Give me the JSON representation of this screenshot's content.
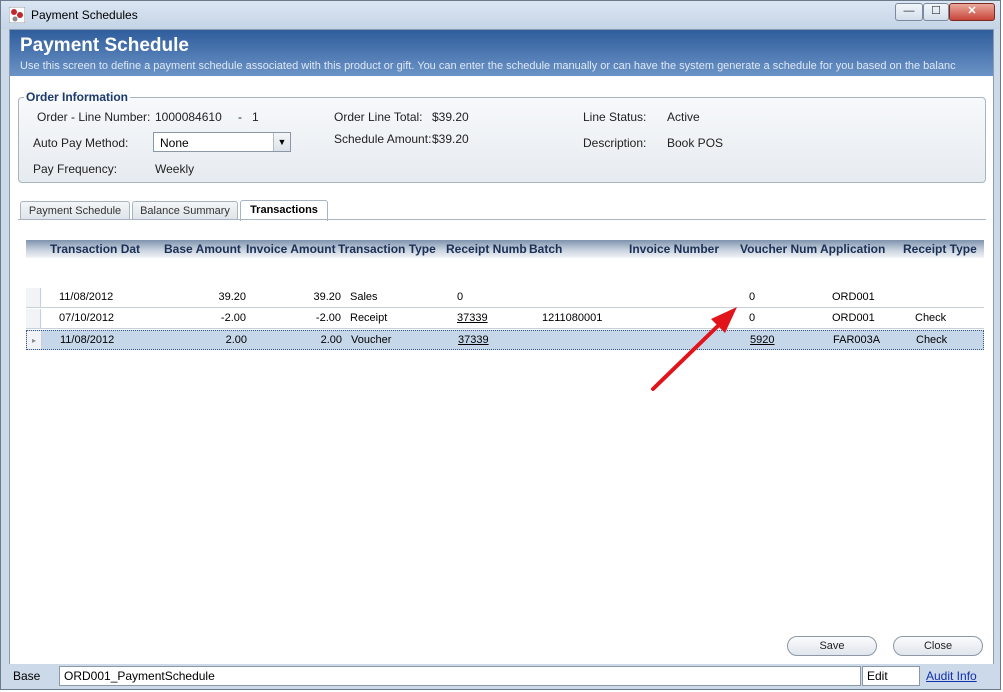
{
  "window": {
    "title": "Payment Schedules",
    "title_controls": {
      "minimize": "—",
      "maximize": "☐",
      "close": "✕"
    }
  },
  "header": {
    "title": "Payment Schedule",
    "subtitle": "Use this screen to define a payment schedule associated with this product or gift. You can enter the schedule manually or can have the system generate a schedule for you based on the balanc"
  },
  "order_info": {
    "legend": "Order Information",
    "order_line_label": "Order - Line Number:",
    "order_number": "1000084610",
    "order_dash": "-",
    "line_number": "1",
    "auto_pay_label": "Auto Pay Method:",
    "auto_pay_value": "None",
    "pay_frequency_label": "Pay Frequency:",
    "pay_frequency_value": "Weekly",
    "order_line_total_label": "Order Line Total:",
    "order_line_total_value": "$39.20",
    "schedule_amount_label": "Schedule Amount:",
    "schedule_amount_value": "$39.20",
    "line_status_label": "Line Status:",
    "line_status_value": "Active",
    "description_label": "Description:",
    "description_value": "Book POS"
  },
  "tabs": [
    {
      "label": "Payment Schedule",
      "active": false
    },
    {
      "label": "Balance Summary",
      "active": false
    },
    {
      "label": "Transactions",
      "active": true
    }
  ],
  "grid": {
    "columns": [
      "Transaction Dat",
      "Base Amount",
      "Invoice Amount",
      "Transaction Type",
      "Receipt Numb",
      "Batch",
      "Invoice Number",
      "Voucher Num",
      "Application",
      "Receipt Type"
    ],
    "rows": [
      {
        "date": "11/08/2012",
        "base": "39.20",
        "invoice": "39.20",
        "type": "Sales",
        "receipt": "0",
        "batch": "",
        "invoice_no": "",
        "voucher": "0",
        "application": "ORD001",
        "receipt_type": ""
      },
      {
        "date": "07/10/2012",
        "base": "-2.00",
        "invoice": "-2.00",
        "type": "Receipt",
        "receipt": "37339",
        "batch": "1211080001",
        "invoice_no": "",
        "voucher": "0",
        "application": "ORD001",
        "receipt_type": "Check"
      },
      {
        "date": "11/08/2012",
        "base": "2.00",
        "invoice": "2.00",
        "type": "Voucher",
        "receipt": "37339",
        "batch": "",
        "invoice_no": "",
        "voucher": "5920",
        "application": "FAR003A",
        "receipt_type": "Check"
      }
    ],
    "selected_row": 2,
    "row_marker": "▸"
  },
  "buttons": {
    "save": "Save",
    "close": "Close"
  },
  "status_bar": {
    "label": "Base",
    "context": "ORD001_PaymentSchedule",
    "mode": "Edit",
    "audit_link": "Audit Info"
  },
  "colors": {
    "header_top": "#2f5d9c",
    "header_bottom": "#6b93c6",
    "selected_row": "#c7d7ea",
    "annotation_arrow": "#e0141a",
    "link": "#1030b0"
  }
}
